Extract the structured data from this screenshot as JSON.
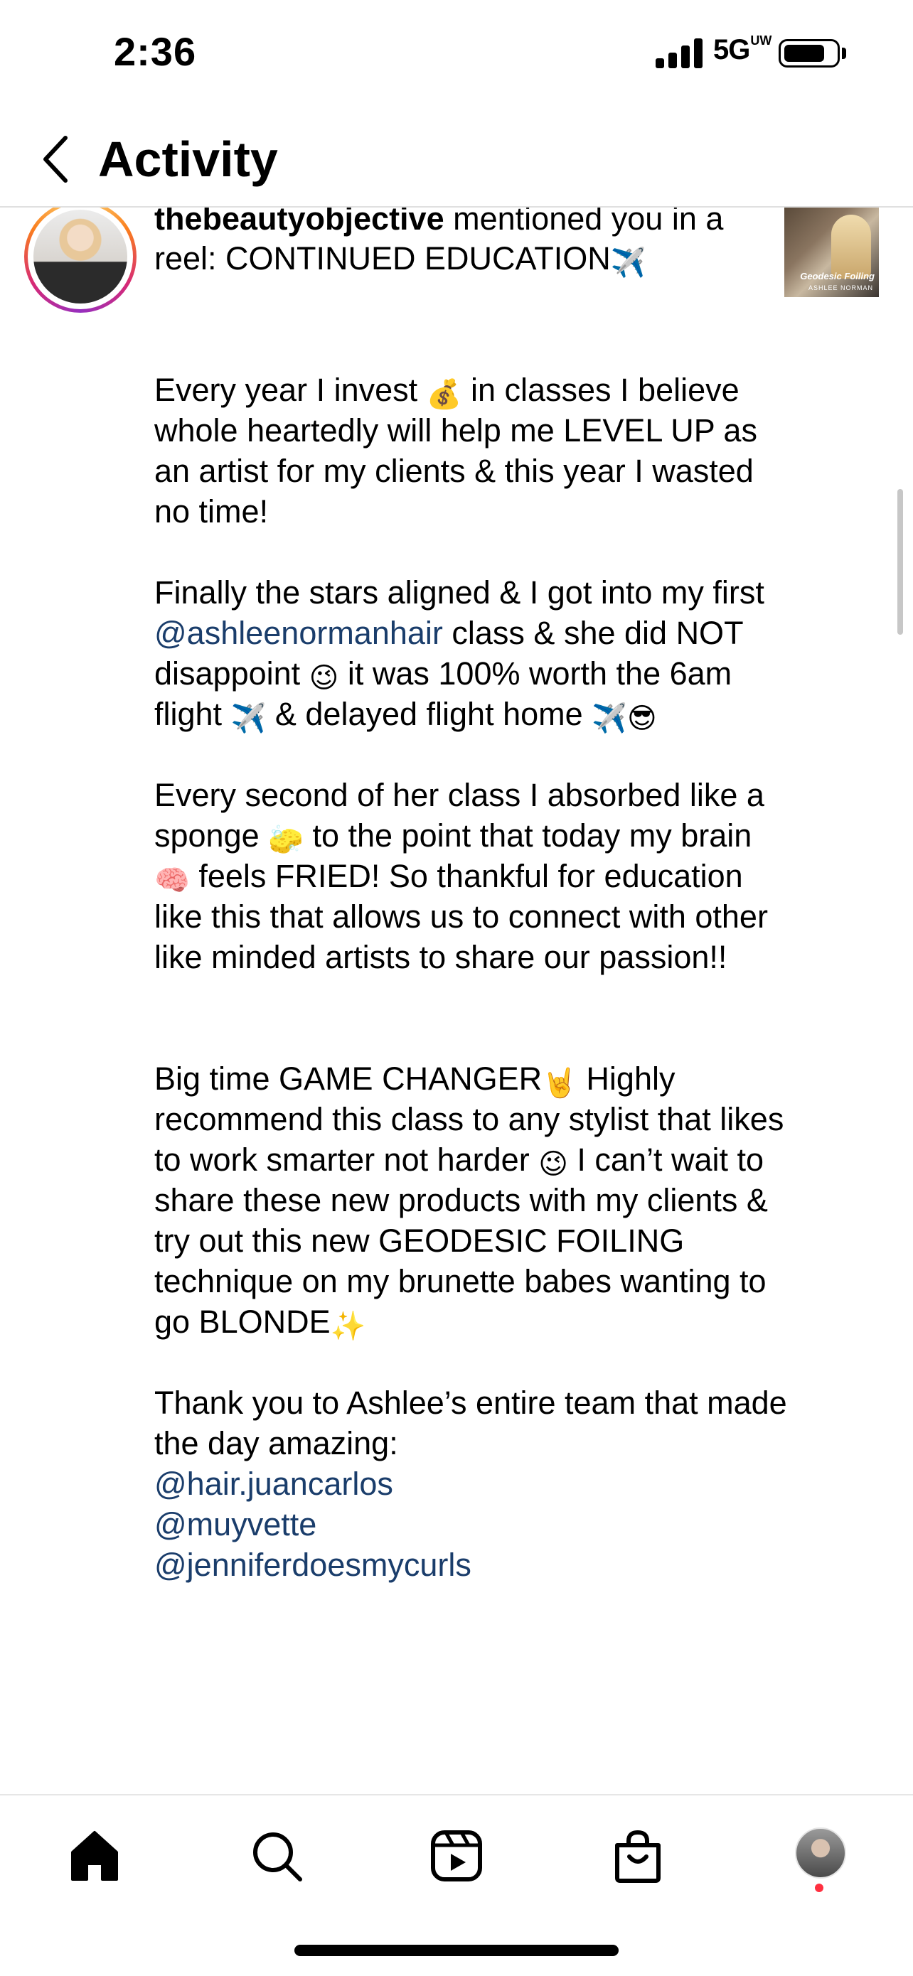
{
  "status_bar": {
    "time": "2:36",
    "network": "5G",
    "network_sup": "UW",
    "battery_level": 0.85
  },
  "header": {
    "title": "Activity",
    "back_icon": "chevron-left-icon"
  },
  "notification": {
    "username": "thebeautyobjective",
    "text": " mentioned you in a reel: CONTINUED EDUCATION",
    "text_emoji": "✈️",
    "thumbnail_caption": "Geodesic Foiling",
    "thumbnail_subcaption": "ASHLEE NORMAN"
  },
  "caption": {
    "p1_a": "Every year I invest ",
    "p1_emoji": "💰",
    "p1_b": " in classes I believe whole heartedly will help me LEVEL UP as an artist for my clients & this year I wasted no time!",
    "p2_a": "Finally the stars aligned & I got into my first ",
    "p2_mention": "@ashleenormanhair",
    "p2_b": " class & she did NOT disappoint ",
    "p2_emoji1": "😉",
    "p2_c": " it was 100% worth the 6am flight ",
    "p2_emoji2": "✈️",
    "p2_d": " & delayed flight home ",
    "p2_emoji3": "✈️😎",
    "p3_a": "Every second of her class I absorbed like a sponge ",
    "p3_emoji1": "🧽",
    "p3_b": " to the point that today my brain ",
    "p3_emoji2": "🧠",
    "p3_c": " feels FRIED! So thankful for education like this that allows us to connect with other like minded artists to share our passion!!",
    "p4_a": "Big time GAME CHANGER",
    "p4_emoji1": "🤘",
    "p4_b": "  Highly recommend this class to any stylist that likes to work smarter not harder ",
    "p4_emoji2": "😉",
    "p4_c": " I can’t wait to share these new products with my clients & try out this new GEODESIC FOILING technique on my brunette babes wanting to go BLONDE",
    "p4_emoji3": "✨",
    "p5_text": "Thank you to Ashlee’s entire team that made the day amazing:",
    "mentions": [
      "@hair.juancarlos",
      "@muyvette",
      "@jenniferdoesmycurls"
    ]
  },
  "tab_bar": {
    "icons": [
      "home-icon",
      "search-icon",
      "reels-icon",
      "shop-icon",
      "profile-avatar"
    ],
    "notification_dot_color": "#ff3040"
  },
  "colors": {
    "mention": "#1a3d6b",
    "ring_gradient": [
      "#feda75",
      "#fa7e1e",
      "#d62976",
      "#962fbf"
    ]
  }
}
